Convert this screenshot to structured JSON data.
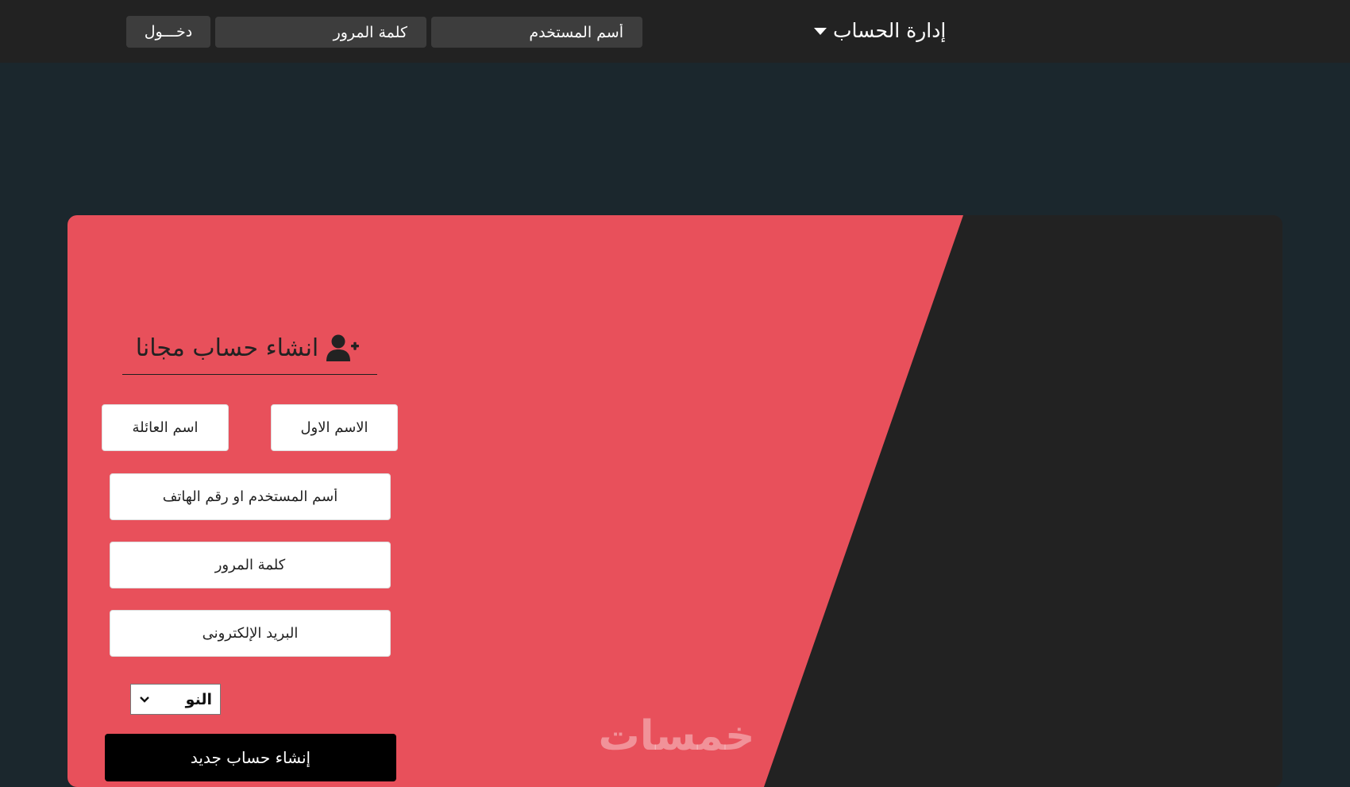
{
  "header": {
    "account_menu_label": "إدارة الحساب",
    "username_placeholder": "أسم المستخدم",
    "password_placeholder": "كلمة المرور",
    "login_label": "دخـــول"
  },
  "signup": {
    "title": "انشاء حساب مجانا",
    "first_name_placeholder": "الاسم الاول",
    "last_name_placeholder": "اسم العائلة",
    "username_placeholder": "أسم المستخدم او رقم الهاتف",
    "password_placeholder": "كلمة المرور",
    "email_placeholder": "البريد الإلكترونى",
    "gender_selected": "النو",
    "submit_label": "إنشاء حساب جديد"
  },
  "watermark": "خمسات",
  "colors": {
    "page_bg": "#1b272d",
    "topbar_bg": "#222222",
    "accent_red": "#e8505b",
    "card_dark": "#222222",
    "button_black": "#000000"
  },
  "icons": {
    "account_menu": "caret-down-icon",
    "signup_title": "user-plus-icon",
    "gender_select": "chevron-down-icon"
  }
}
